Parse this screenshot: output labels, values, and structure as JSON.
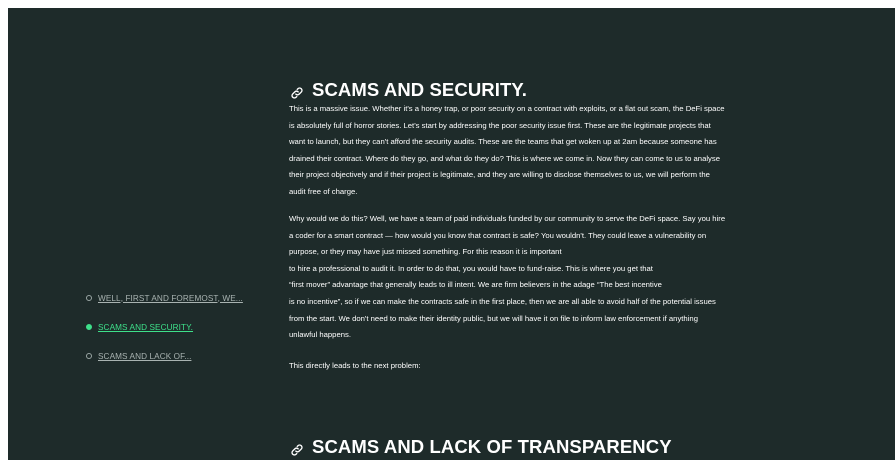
{
  "toc": {
    "items": [
      {
        "label": "WELL, FIRST AND FOREMOST, WE...",
        "active": false
      },
      {
        "label": "SCAMS AND SECURITY.",
        "active": true
      },
      {
        "label": "SCAMS AND LACK OF...",
        "active": false
      }
    ]
  },
  "article": {
    "sections": [
      {
        "heading": "SCAMS AND SECURITY.",
        "icon": "link-icon",
        "paragraphs": [
          [
            "This is a massive issue. Whether it's a honey trap, or poor security on a contract with exploits, or a flat out scam, the DeFi space",
            "is absolutely full of horror stories. Let's start by addressing the poor security issue first. These are the legitimate projects that",
            "want to launch, but they can't afford the security audits. These are the teams that get woken up at 2am because someone has",
            "drained their contract. Where do they go, and what do they do? This is where we come in. Now they can come to us to analyse",
            "their project objectively and if their project is legitimate, and they are willing to disclose themselves to us, we will perform the",
            "audit free of charge."
          ],
          [
            "Why would we do this? Well, we have a team of paid individuals funded by our community to serve the DeFi space. Say you hire",
            "a coder for a smart contract — how would you know that contract is safe? You wouldn't. They could leave a vulnerability on",
            "purpose, or they may have just missed something. For this reason it is important",
            "to hire a professional to audit it. In order to do that, you would have to fund-raise. This is where you get that",
            "“first mover” advantage that generally leads to ill intent. We are firm believers in the adage “The best incentive",
            "is no incentive”, so if we can make the contracts safe in the first place, then we are all able to avoid half of the potential issues",
            "from the start. We don't need to make their identity public, but we will have it on file to inform law enforcement if anything",
            "unlawful happens."
          ],
          [
            "This directly leads to the next problem:"
          ]
        ]
      },
      {
        "heading": "SCAMS AND LACK OF TRANSPARENCY",
        "icon": "link-icon"
      }
    ]
  },
  "colors": {
    "background": "#1e2b2a",
    "accent": "#3ee08a",
    "text": "#ffffff",
    "muted": "#a9b3b1"
  }
}
